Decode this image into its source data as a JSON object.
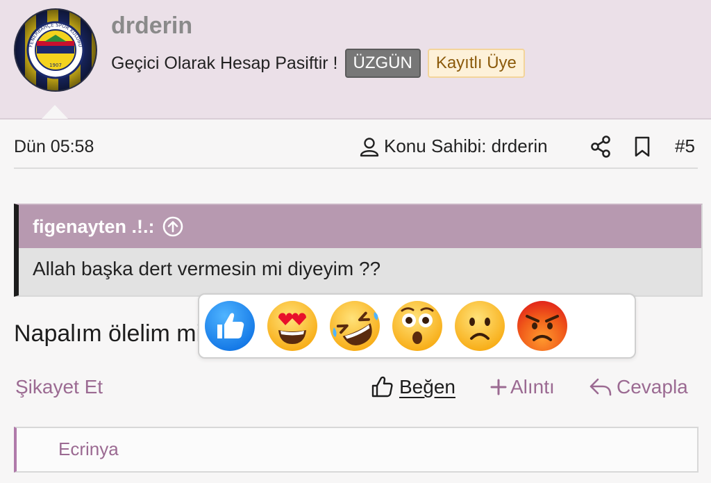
{
  "header": {
    "username": "drderin",
    "status_text": "Geçici Olarak Hesap Pasiftir !",
    "mood_badge": "ÜZGÜN",
    "role_badge": "Kayıtlı Üye",
    "avatar": {
      "type": "club-crest",
      "crest_text": "FENERBAHÇE SPOR KULÜBÜ",
      "crest_year": "1907",
      "colors": {
        "navy": "#1b2a6b",
        "yellow": "#e2c21a"
      }
    }
  },
  "meta": {
    "date": "Dün 05:58",
    "owner_label": "Konu Sahibi: drderin",
    "post_number": "#5",
    "icons": [
      "user-icon",
      "share-icon",
      "bookmark-icon"
    ]
  },
  "quote": {
    "author": "figenayten .!.:",
    "text": "Allah başka dert vermesin mi diyeyim ??",
    "icon": "arrow-up-circle-icon"
  },
  "post": {
    "text": "Napalım ölelim mi"
  },
  "reactions": [
    {
      "name": "like",
      "icon": "thumbs-up"
    },
    {
      "name": "love",
      "icon": "heart-eyes"
    },
    {
      "name": "haha",
      "icon": "rolling-laugh"
    },
    {
      "name": "wow",
      "icon": "astonished"
    },
    {
      "name": "sad",
      "icon": "frown"
    },
    {
      "name": "angry",
      "icon": "angry-face"
    }
  ],
  "actions": {
    "report": "Şikayet Et",
    "like": "Beğen",
    "quote": "Alıntı",
    "reply": "Cevapla"
  },
  "likers": {
    "name": "Ecrinya"
  },
  "colors": {
    "accent": "#9b6a92",
    "header_bg": "#ebe0e8",
    "quote_head_bg": "#b799b0"
  }
}
